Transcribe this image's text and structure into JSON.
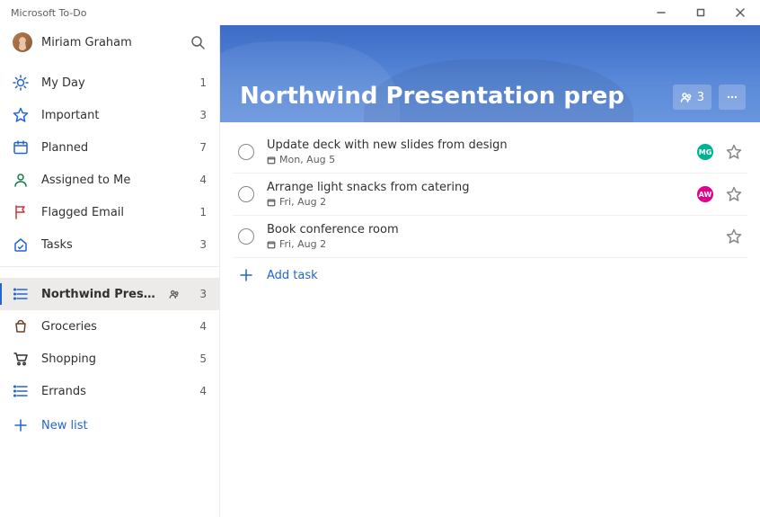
{
  "window": {
    "app_title": "Microsoft To-Do"
  },
  "user": {
    "name": "Miriam Graham"
  },
  "sidebar": {
    "smart_lists": [
      {
        "id": "myday",
        "label": "My Day",
        "count": 1
      },
      {
        "id": "important",
        "label": "Important",
        "count": 3
      },
      {
        "id": "planned",
        "label": "Planned",
        "count": 7
      },
      {
        "id": "assigned",
        "label": "Assigned to Me",
        "count": 4
      },
      {
        "id": "flagged",
        "label": "Flagged Email",
        "count": 1
      },
      {
        "id": "tasks",
        "label": "Tasks",
        "count": 3
      }
    ],
    "custom_lists": [
      {
        "id": "northwind",
        "label": "Northwind Presentation…",
        "count": 3,
        "shared": true,
        "active": true,
        "icon": "list"
      },
      {
        "id": "groceries",
        "label": "Groceries",
        "count": 4,
        "icon": "groceries"
      },
      {
        "id": "shopping",
        "label": "Shopping",
        "count": 5,
        "icon": "shopping"
      },
      {
        "id": "errands",
        "label": "Errands",
        "count": 4,
        "icon": "list"
      }
    ],
    "new_list_label": "New list"
  },
  "main": {
    "list_title": "Northwind Presentation prep",
    "share_count": 3,
    "tasks": [
      {
        "title": "Update deck with new slides from design",
        "due": "Mon, Aug 5",
        "assignee": {
          "initials": "MG",
          "color": "green"
        }
      },
      {
        "title": "Arrange light snacks from catering",
        "due": "Fri, Aug 2",
        "assignee": {
          "initials": "AW",
          "color": "pink"
        }
      },
      {
        "title": "Book conference room",
        "due": "Fri, Aug 2"
      }
    ],
    "add_task_label": "Add task"
  }
}
